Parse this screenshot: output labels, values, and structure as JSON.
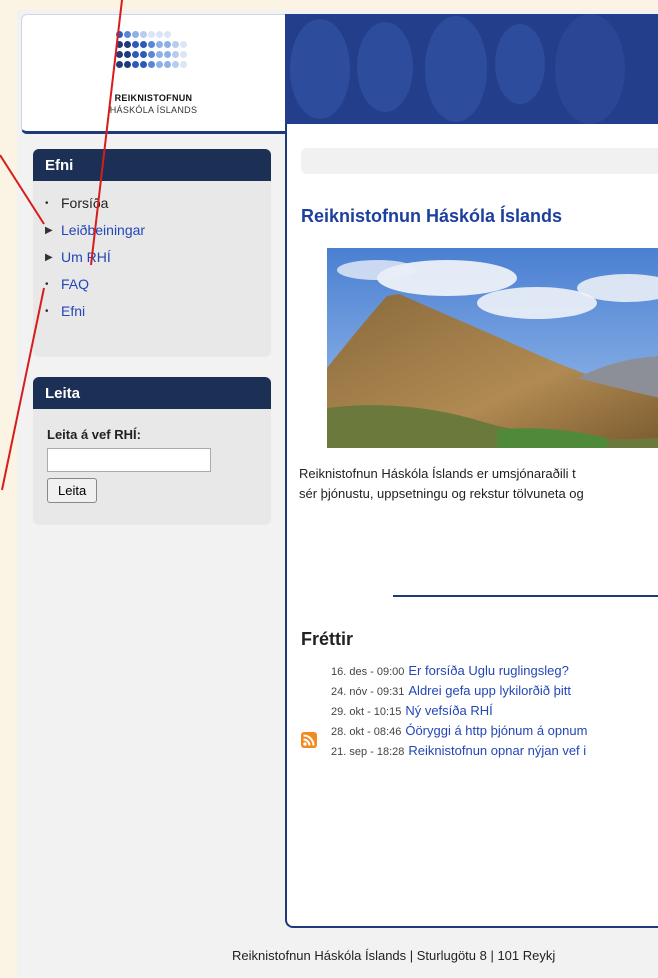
{
  "header": {
    "logo_name": "REIKNISTOFNUN",
    "logo_sub": "HÁSKÓLA ÍSLANDS"
  },
  "sidebar": {
    "efni_title": "Efni",
    "items": [
      {
        "label": "Forsíða",
        "bullet": "•",
        "link": false
      },
      {
        "label": "Leiðbeiningar",
        "bullet": "▶",
        "link": true
      },
      {
        "label": "Um RHÍ",
        "bullet": "▶",
        "link": true
      },
      {
        "label": "FAQ",
        "bullet": "•",
        "link": true
      },
      {
        "label": "Efni",
        "bullet": "•",
        "link": true
      }
    ],
    "search_title": "Leita",
    "search_label": "Leita á vef RHÍ:",
    "search_value": "",
    "search_button": "Leita"
  },
  "main": {
    "title": "Reiknistofnun Háskóla Íslands",
    "intro_line1": "Reiknistofnun Háskóla Íslands er umsjónaraðili t",
    "intro_line2": "sér þjónustu, uppsetningu og rekstur tölvuneta og",
    "news_title": "Fréttir",
    "news": [
      {
        "date": "16. des - 09:00",
        "title": "Er forsíða Uglu ruglingsleg?"
      },
      {
        "date": "24. nóv - 09:31",
        "title": "Aldrei gefa upp lykilorðið þitt"
      },
      {
        "date": "29. okt - 10:15",
        "title": "Ný vefsíða RHÍ"
      },
      {
        "date": "28. okt - 08:46",
        "title": "Óöryggi á http þjónum á opnum"
      },
      {
        "date": "21. sep - 18:28",
        "title": "Reiknistofnun opnar nýjan vef i"
      }
    ]
  },
  "footer": {
    "text": "Reiknistofnun Háskóla Íslands | Sturlugötu 8 | 101 Reykj"
  },
  "colors": {
    "nav_dark": "#1c2f55",
    "accent_blue": "#1d3f9e",
    "link": "#2446b7",
    "annotation": "#d81c1c"
  }
}
